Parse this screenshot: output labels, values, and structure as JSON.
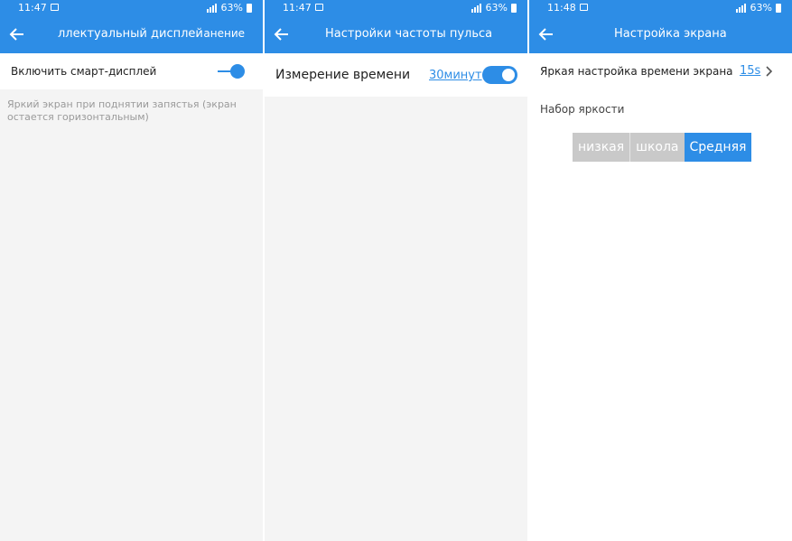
{
  "colors": {
    "accent": "#2d8de6",
    "bg": "#f4f4f4"
  },
  "panel1": {
    "status": {
      "time": "11:47",
      "battery": "63%"
    },
    "title": "ллектуальный дисплей",
    "action": "анение",
    "toggle_label": "Включить смарт-дисплей",
    "toggle_on": true,
    "hint": "Яркий экран при поднятии запястья (экран остается горизонтальным)"
  },
  "panel2": {
    "status": {
      "time": "11:47",
      "battery": "63%"
    },
    "title": "Настройки частоты пульса",
    "row_label": "Измерение времени",
    "row_value": "30минут",
    "toggle_on": true
  },
  "panel3": {
    "status": {
      "time": "11:48",
      "battery": "63%"
    },
    "title": "Настройка экрана",
    "row_label": "Яркая настройка времени экрана",
    "row_value": "15s",
    "section_label": "Набор яркости",
    "segments": [
      "низкая",
      "школа",
      "Средняя"
    ],
    "selected_segment": "Средняя"
  }
}
